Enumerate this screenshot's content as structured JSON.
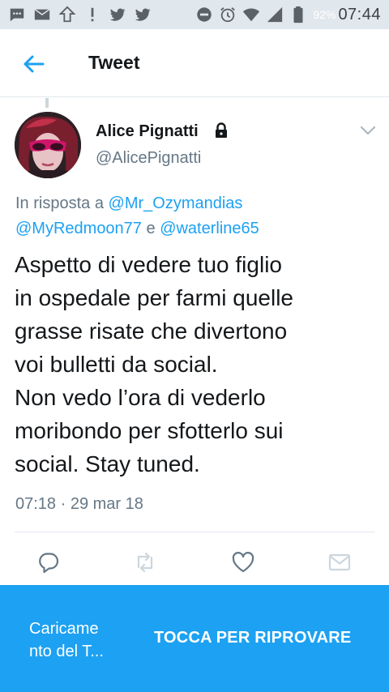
{
  "status_bar": {
    "battery_percent": "92%",
    "time": "07:44",
    "icons": [
      "messages-icon",
      "mail-icon",
      "upload-icon",
      "alert-icon",
      "twitter-icon",
      "twitter-icon",
      "do-not-disturb-icon",
      "alarm-icon",
      "wifi-icon",
      "cell-signal-icon",
      "battery-icon"
    ]
  },
  "header": {
    "title": "Tweet",
    "back_icon": "arrow-left-icon"
  },
  "tweet": {
    "author_name": "Alice Pignatti",
    "author_handle": "@AlicePignatti",
    "protected_icon": "lock-icon",
    "reply_prefix": "In risposta a",
    "reply_mentions": [
      "@Mr_Ozymandias",
      "@MyRedmoon77",
      "@waterline65"
    ],
    "reply_conjunction": "e",
    "text_lines": [
      "Aspetto di vedere tuo figlio",
      "in ospedale per farmi quelle",
      "grasse risate che divertono",
      "voi bulletti da social.",
      "Non vedo l’ora di vederlo",
      "moribondo per sfotterlo sui",
      "social. Stay tuned."
    ],
    "timestamp": "07:18 · 29 mar 18",
    "actions": [
      "reply-icon",
      "retweet-icon",
      "like-icon",
      "direct-message-icon"
    ]
  },
  "snackbar": {
    "message_lines": [
      "Caricame",
      "nto del T..."
    ],
    "action_label": "TOCCA PER RIPROVARE"
  },
  "colors": {
    "accent": "#1da1f2",
    "secondary_text": "#657786",
    "status_bar_bg": "#e1e8ed"
  }
}
